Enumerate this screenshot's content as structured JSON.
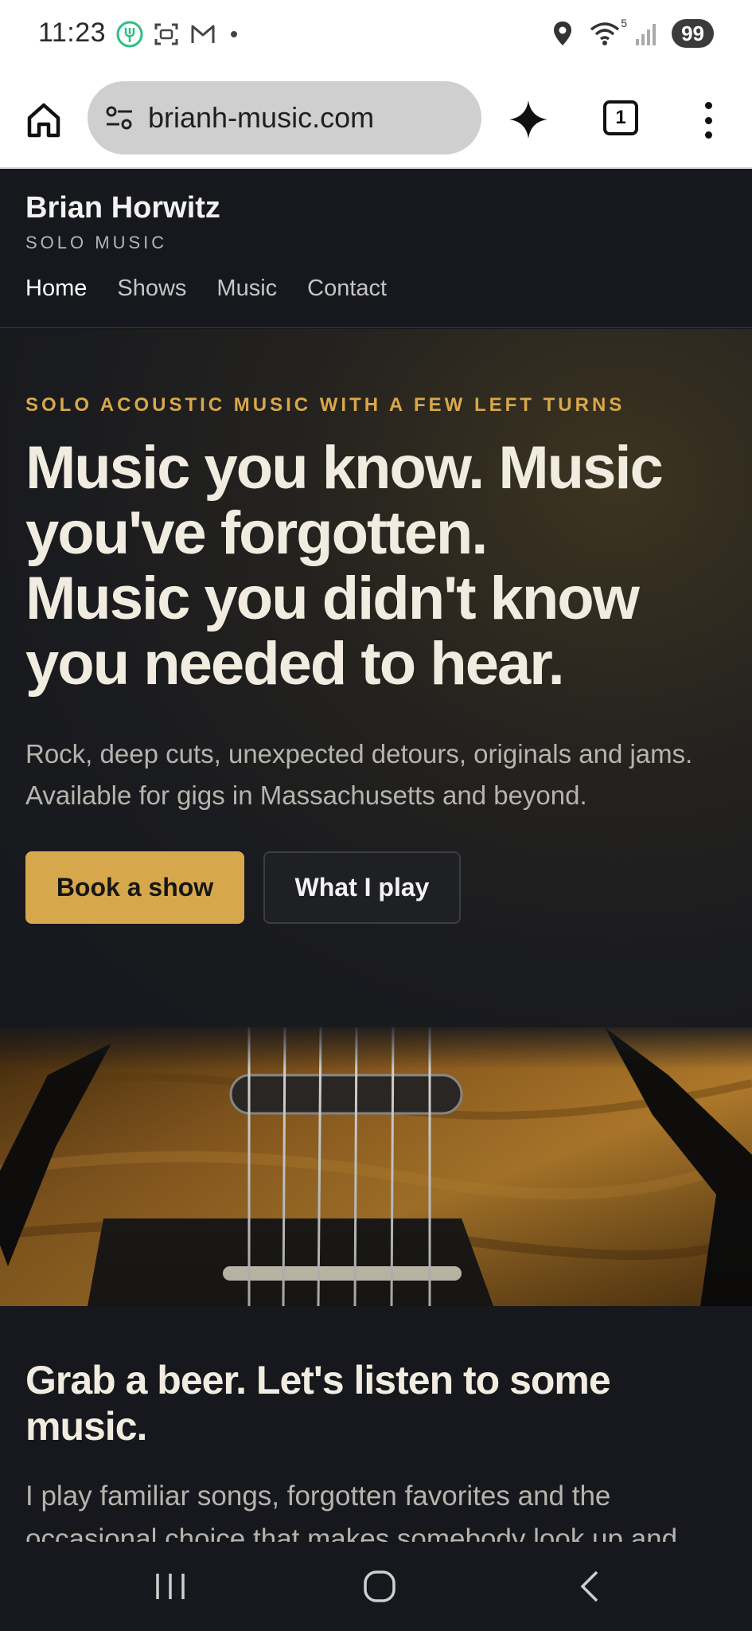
{
  "status": {
    "time": "11:23",
    "battery": "99",
    "wifi_badge": "5",
    "icons": [
      "grubhub-icon",
      "screenshot-icon",
      "gmail-icon",
      "location-icon",
      "wifi-icon",
      "signal-icon"
    ]
  },
  "browser": {
    "url": "brianh-music.com",
    "tab_count": "1",
    "icons": [
      "home-icon",
      "site-settings-icon",
      "gemini-spark-icon",
      "tabs-icon",
      "more-menu-icon"
    ]
  },
  "site": {
    "brand_name": "Brian Horwitz",
    "brand_sub": "SOLO MUSIC",
    "nav": [
      {
        "label": "Home",
        "active": true
      },
      {
        "label": "Shows"
      },
      {
        "label": "Music"
      },
      {
        "label": "Contact"
      }
    ]
  },
  "hero": {
    "kicker": "SOLO ACOUSTIC MUSIC WITH A FEW LEFT TURNS",
    "headline_line1": "Music you know. Music you've forgotten.",
    "headline_line2": "Music you didn't know you needed to hear.",
    "subtext": "Rock, deep cuts, unexpected detours, originals and jams. Available for gigs in Massachusetts and beyond.",
    "primary_button": "Book a show",
    "secondary_button": "What I play"
  },
  "intro": {
    "title": "Grab a beer. Let's listen to some music.",
    "text": "I play familiar songs, forgotten favorites and the occasional choice that makes somebody look up and"
  },
  "colors": {
    "accent": "#d7a84b",
    "background": "#16181d",
    "headline": "#f1ece0"
  }
}
